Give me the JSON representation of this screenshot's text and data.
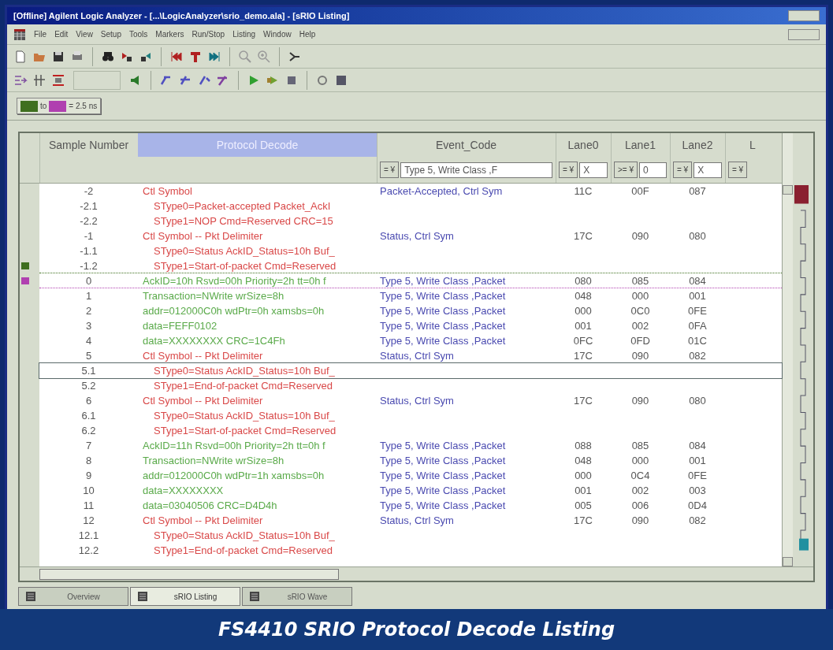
{
  "window": {
    "title": "[Offline] Agilent Logic Analyzer - [...\\LogicAnalyzer\\srio_demo.ala] - [sRIO Listing]"
  },
  "menu": [
    "File",
    "Edit",
    "View",
    "Setup",
    "Tools",
    "Markers",
    "Run/Stop",
    "Listing",
    "Window",
    "Help"
  ],
  "marker_readout": {
    "connector": "to",
    "value": "= 2.5 ns"
  },
  "table": {
    "columns": [
      {
        "label": "Sample Number",
        "selected": false
      },
      {
        "label": "Protocol Decode",
        "selected": true
      },
      {
        "label": "Event_Code",
        "selected": false,
        "filter_op": "= ¥",
        "filter_value": "Type 5, Write Class ,F"
      },
      {
        "label": "Lane0",
        "selected": false,
        "filter_op": "= ¥",
        "filter_value": "X"
      },
      {
        "label": "Lane1",
        "selected": false,
        "filter_op": ">= ¥",
        "filter_value": "0"
      },
      {
        "label": "Lane2",
        "selected": false,
        "filter_op": "= ¥",
        "filter_value": "X"
      },
      {
        "label": "L",
        "selected": false,
        "filter_op": "= ¥"
      }
    ],
    "rows": [
      {
        "sample": "-2",
        "decode": "Ctl Symbol",
        "color": "#d94848",
        "event": "Packet-Accepted, Ctrl Sym",
        "lanes": [
          "11C",
          "00F",
          "087"
        ],
        "selected": false,
        "children": [
          {
            "sample": "-2.1",
            "decode": "SType0=Packet-accepted Packet_AckI",
            "color": "#d94848",
            "selected": false
          },
          {
            "sample": "-2.2",
            "decode": "SType1=NOP Cmd=Reserved CRC=15",
            "color": "#d94848",
            "selected": false
          }
        ]
      },
      {
        "sample": "-1",
        "decode": "Ctl Symbol -- Pkt Delimiter",
        "color": "#d94848",
        "event": "Status, Ctrl Sym",
        "lanes": [
          "17C",
          "090",
          "080"
        ],
        "selected": false,
        "children": [
          {
            "sample": "-1.1",
            "decode": "SType0=Status AckID_Status=10h Buf_",
            "color": "#d94848",
            "selected": false
          },
          {
            "sample": "-1.2",
            "decode": "SType1=Start-of-packet Cmd=Reserved",
            "color": "#d94848",
            "selected": false,
            "marker": {
              "color": "#3f6f1f"
            }
          }
        ]
      },
      {
        "sample": "0",
        "decode": "AckID=10h Rsvd=00h Priority=2h tt=0h f",
        "color": "#5aaa4a",
        "event": "Type 5, Write Class ,Packet",
        "lanes": [
          "080",
          "085",
          "084"
        ],
        "selected": false,
        "marker": {
          "color": "#b040b0"
        }
      },
      {
        "sample": "1",
        "decode": "Transaction=NWrite wrSize=8h",
        "color": "#5aaa4a",
        "event": "Type 5, Write Class ,Packet",
        "lanes": [
          "048",
          "000",
          "001"
        ],
        "selected": false
      },
      {
        "sample": "2",
        "decode": "addr=012000C0h wdPtr=0h xamsbs=0h",
        "color": "#5aaa4a",
        "event": "Type 5, Write Class ,Packet",
        "lanes": [
          "000",
          "0C0",
          "0FE"
        ],
        "selected": false
      },
      {
        "sample": "3",
        "decode": "data=FEFF0102",
        "color": "#5aaa4a",
        "event": "Type 5, Write Class ,Packet",
        "lanes": [
          "001",
          "002",
          "0FA"
        ],
        "selected": false
      },
      {
        "sample": "4",
        "decode": "data=XXXXXXXX CRC=1C4Fh",
        "color": "#5aaa4a",
        "event": "Type 5, Write Class ,Packet",
        "lanes": [
          "0FC",
          "0FD",
          "01C"
        ],
        "selected": false
      },
      {
        "sample": "5",
        "decode": "Ctl Symbol -- Pkt Delimiter",
        "color": "#d94848",
        "event": "Status, Ctrl Sym",
        "lanes": [
          "17C",
          "090",
          "082"
        ],
        "selected": false,
        "children": [
          {
            "sample": "5.1",
            "decode": "SType0=Status AckID_Status=10h Buf_",
            "color": "#d94848",
            "selected": true
          },
          {
            "sample": "5.2",
            "decode": "SType1=End-of-packet Cmd=Reserved",
            "color": "#d94848",
            "selected": false
          }
        ]
      },
      {
        "sample": "6",
        "decode": "Ctl Symbol -- Pkt Delimiter",
        "color": "#d94848",
        "event": "Status, Ctrl Sym",
        "lanes": [
          "17C",
          "090",
          "080"
        ],
        "selected": false,
        "children": [
          {
            "sample": "6.1",
            "decode": "SType0=Status AckID_Status=10h Buf_",
            "color": "#d94848",
            "selected": false
          },
          {
            "sample": "6.2",
            "decode": "SType1=Start-of-packet Cmd=Reserved",
            "color": "#d94848",
            "selected": false
          }
        ]
      },
      {
        "sample": "7",
        "decode": "AckID=11h Rsvd=00h Priority=2h tt=0h f",
        "color": "#5aaa4a",
        "event": "Type 5, Write Class ,Packet",
        "lanes": [
          "088",
          "085",
          "084"
        ],
        "selected": false
      },
      {
        "sample": "8",
        "decode": "Transaction=NWrite wrSize=8h",
        "color": "#5aaa4a",
        "event": "Type 5, Write Class ,Packet",
        "lanes": [
          "048",
          "000",
          "001"
        ],
        "selected": false
      },
      {
        "sample": "9",
        "decode": "addr=012000C0h wdPtr=1h xamsbs=0h",
        "color": "#5aaa4a",
        "event": "Type 5, Write Class ,Packet",
        "lanes": [
          "000",
          "0C4",
          "0FE"
        ],
        "selected": false
      },
      {
        "sample": "10",
        "decode": "data=XXXXXXXX",
        "color": "#5aaa4a",
        "event": "Type 5, Write Class ,Packet",
        "lanes": [
          "001",
          "002",
          "003"
        ],
        "selected": false
      },
      {
        "sample": "11",
        "decode": "data=03040506 CRC=D4D4h",
        "color": "#5aaa4a",
        "event": "Type 5, Write Class ,Packet",
        "lanes": [
          "005",
          "006",
          "0D4"
        ],
        "selected": false
      },
      {
        "sample": "12",
        "decode": "Ctl Symbol -- Pkt Delimiter",
        "color": "#d94848",
        "event": "Status, Ctrl Sym",
        "lanes": [
          "17C",
          "090",
          "082"
        ],
        "selected": false,
        "children": [
          {
            "sample": "12.1",
            "decode": "SType0=Status AckID_Status=10h Buf_",
            "color": "#d94848",
            "selected": false
          },
          {
            "sample": "12.2",
            "decode": "SType1=End-of-packet Cmd=Reserved",
            "color": "#d94848",
            "selected": false
          }
        ]
      }
    ]
  },
  "tabs": [
    {
      "label": "Overview",
      "selected": false
    },
    {
      "label": "sRIO Listing",
      "selected": true
    },
    {
      "label": "sRIO Wave",
      "selected": false
    }
  ],
  "caption": "FS4410 SRIO Protocol Decode Listing"
}
